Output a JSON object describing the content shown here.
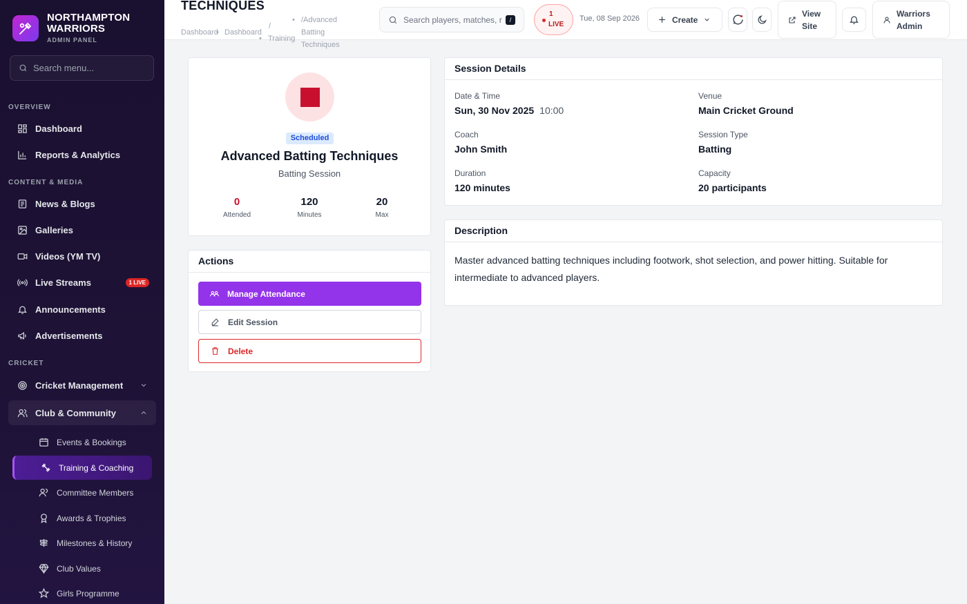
{
  "brand": {
    "name_line1": "NORTHAMPTON",
    "name_line2": "WARRIORS",
    "subtitle": "ADMIN PANEL"
  },
  "sidebar": {
    "search_placeholder": "Search menu...",
    "sections": {
      "overview": "OVERVIEW",
      "content": "CONTENT & MEDIA",
      "cricket": "CRICKET"
    },
    "items": {
      "dashboard": "Dashboard",
      "reports": "Reports & Analytics",
      "news": "News & Blogs",
      "galleries": "Galleries",
      "videos": "Videos (YM TV)",
      "live_streams": "Live Streams",
      "live_badge": "1 LIVE",
      "announcements": "Announcements",
      "advertisements": "Advertisements",
      "cricket_mgmt": "Cricket Management",
      "club_community": "Club & Community"
    },
    "sub_items": {
      "events": "Events & Bookings",
      "training": "Training & Coaching",
      "committee": "Committee Members",
      "awards": "Awards & Trophies",
      "milestones": "Milestones & History",
      "values": "Club Values",
      "girls": "Girls Programme"
    }
  },
  "header": {
    "title": "TECHNIQUES",
    "breadcrumb": {
      "c1": "Dashboard",
      "c2": "Dashboard",
      "c3": "/",
      "c4": "Training",
      "c5": "/Advanced",
      "c6": "Batting",
      "c7": "Techniques"
    },
    "search_placeholder": "Search players, matches, r",
    "search_shortcut": "/",
    "live": {
      "count": "1",
      "label": "LIVE"
    },
    "date": "Tue, 08 Sep 2026",
    "create_label": "Create",
    "view_site_line1": "View",
    "view_site_line2": "Site",
    "user_line1": "Warriors",
    "user_line2": "Admin"
  },
  "profile": {
    "status": "Scheduled",
    "title": "Advanced Batting Techniques",
    "subtitle": "Batting Session",
    "stats": [
      {
        "value": "0",
        "label": "Attended"
      },
      {
        "value": "120",
        "label": "Minutes"
      },
      {
        "value": "20",
        "label": "Max"
      }
    ]
  },
  "actions": {
    "title": "Actions",
    "manage": "Manage Attendance",
    "edit": "Edit Session",
    "delete": "Delete"
  },
  "details": {
    "title": "Session Details",
    "date_label": "Date & Time",
    "date_value": "Sun, 30 Nov 2025",
    "time_value": "10:00",
    "venue_label": "Venue",
    "venue_value": "Main Cricket Ground",
    "coach_label": "Coach",
    "coach_value": "John Smith",
    "type_label": "Session Type",
    "type_value": "Batting",
    "duration_label": "Duration",
    "duration_value": "120 minutes",
    "capacity_label": "Capacity",
    "capacity_value": "20 participants"
  },
  "description": {
    "title": "Description",
    "text": "Master advanced batting techniques including footwork, shot selection, and power hitting. Suitable for intermediate to advanced players."
  },
  "colors": {
    "brand_purple": "#9333ea",
    "sidebar_bg": "#1a1030",
    "danger": "#dc2626",
    "accent_red": "#c8102e",
    "status_blue": "#1d4ed8"
  }
}
